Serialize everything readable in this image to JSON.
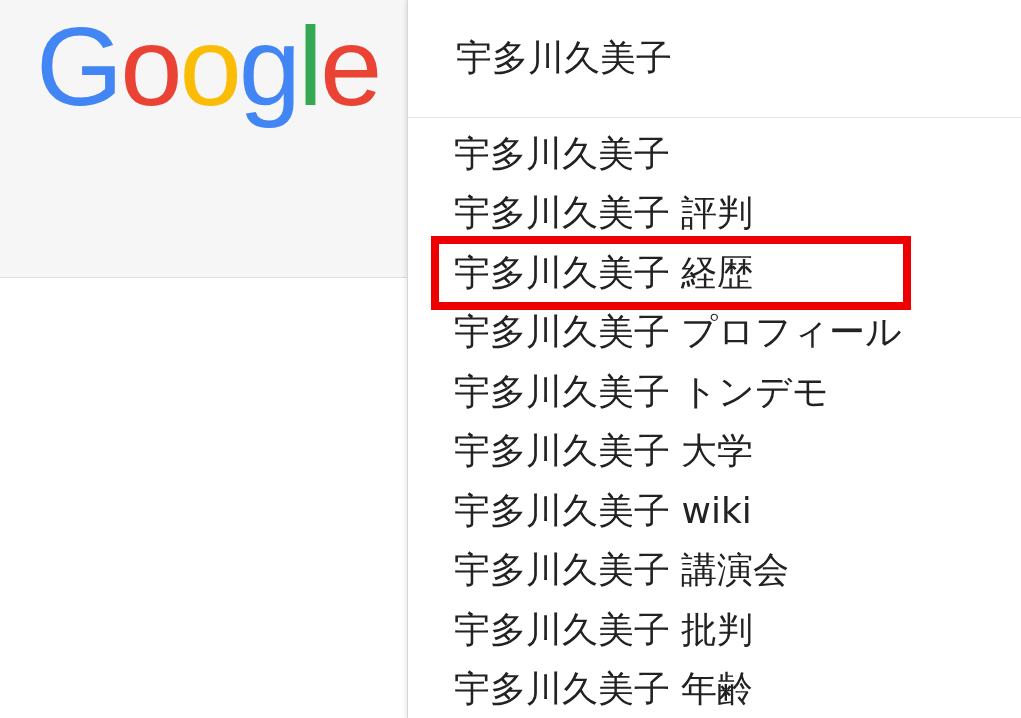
{
  "logo": {
    "letters": [
      {
        "char": "G",
        "color": "#4285f4"
      },
      {
        "char": "o",
        "color": "#ea4335"
      },
      {
        "char": "o",
        "color": "#fbbc05"
      },
      {
        "char": "g",
        "color": "#4285f4"
      },
      {
        "char": "l",
        "color": "#34a853"
      },
      {
        "char": "e",
        "color": "#ea4335"
      }
    ]
  },
  "search": {
    "value": "宇多川久美子"
  },
  "suggestions": [
    {
      "text": "宇多川久美子",
      "highlighted": false
    },
    {
      "text": "宇多川久美子 評判",
      "highlighted": false
    },
    {
      "text": "宇多川久美子 経歴",
      "highlighted": true
    },
    {
      "text": "宇多川久美子 プロフィール",
      "highlighted": false
    },
    {
      "text": "宇多川久美子 トンデモ",
      "highlighted": false
    },
    {
      "text": "宇多川久美子 大学",
      "highlighted": false
    },
    {
      "text": "宇多川久美子 wiki",
      "highlighted": false
    },
    {
      "text": "宇多川久美子 講演会",
      "highlighted": false
    },
    {
      "text": "宇多川久美子 批判",
      "highlighted": false
    },
    {
      "text": "宇多川久美子 年齢",
      "highlighted": false
    }
  ]
}
